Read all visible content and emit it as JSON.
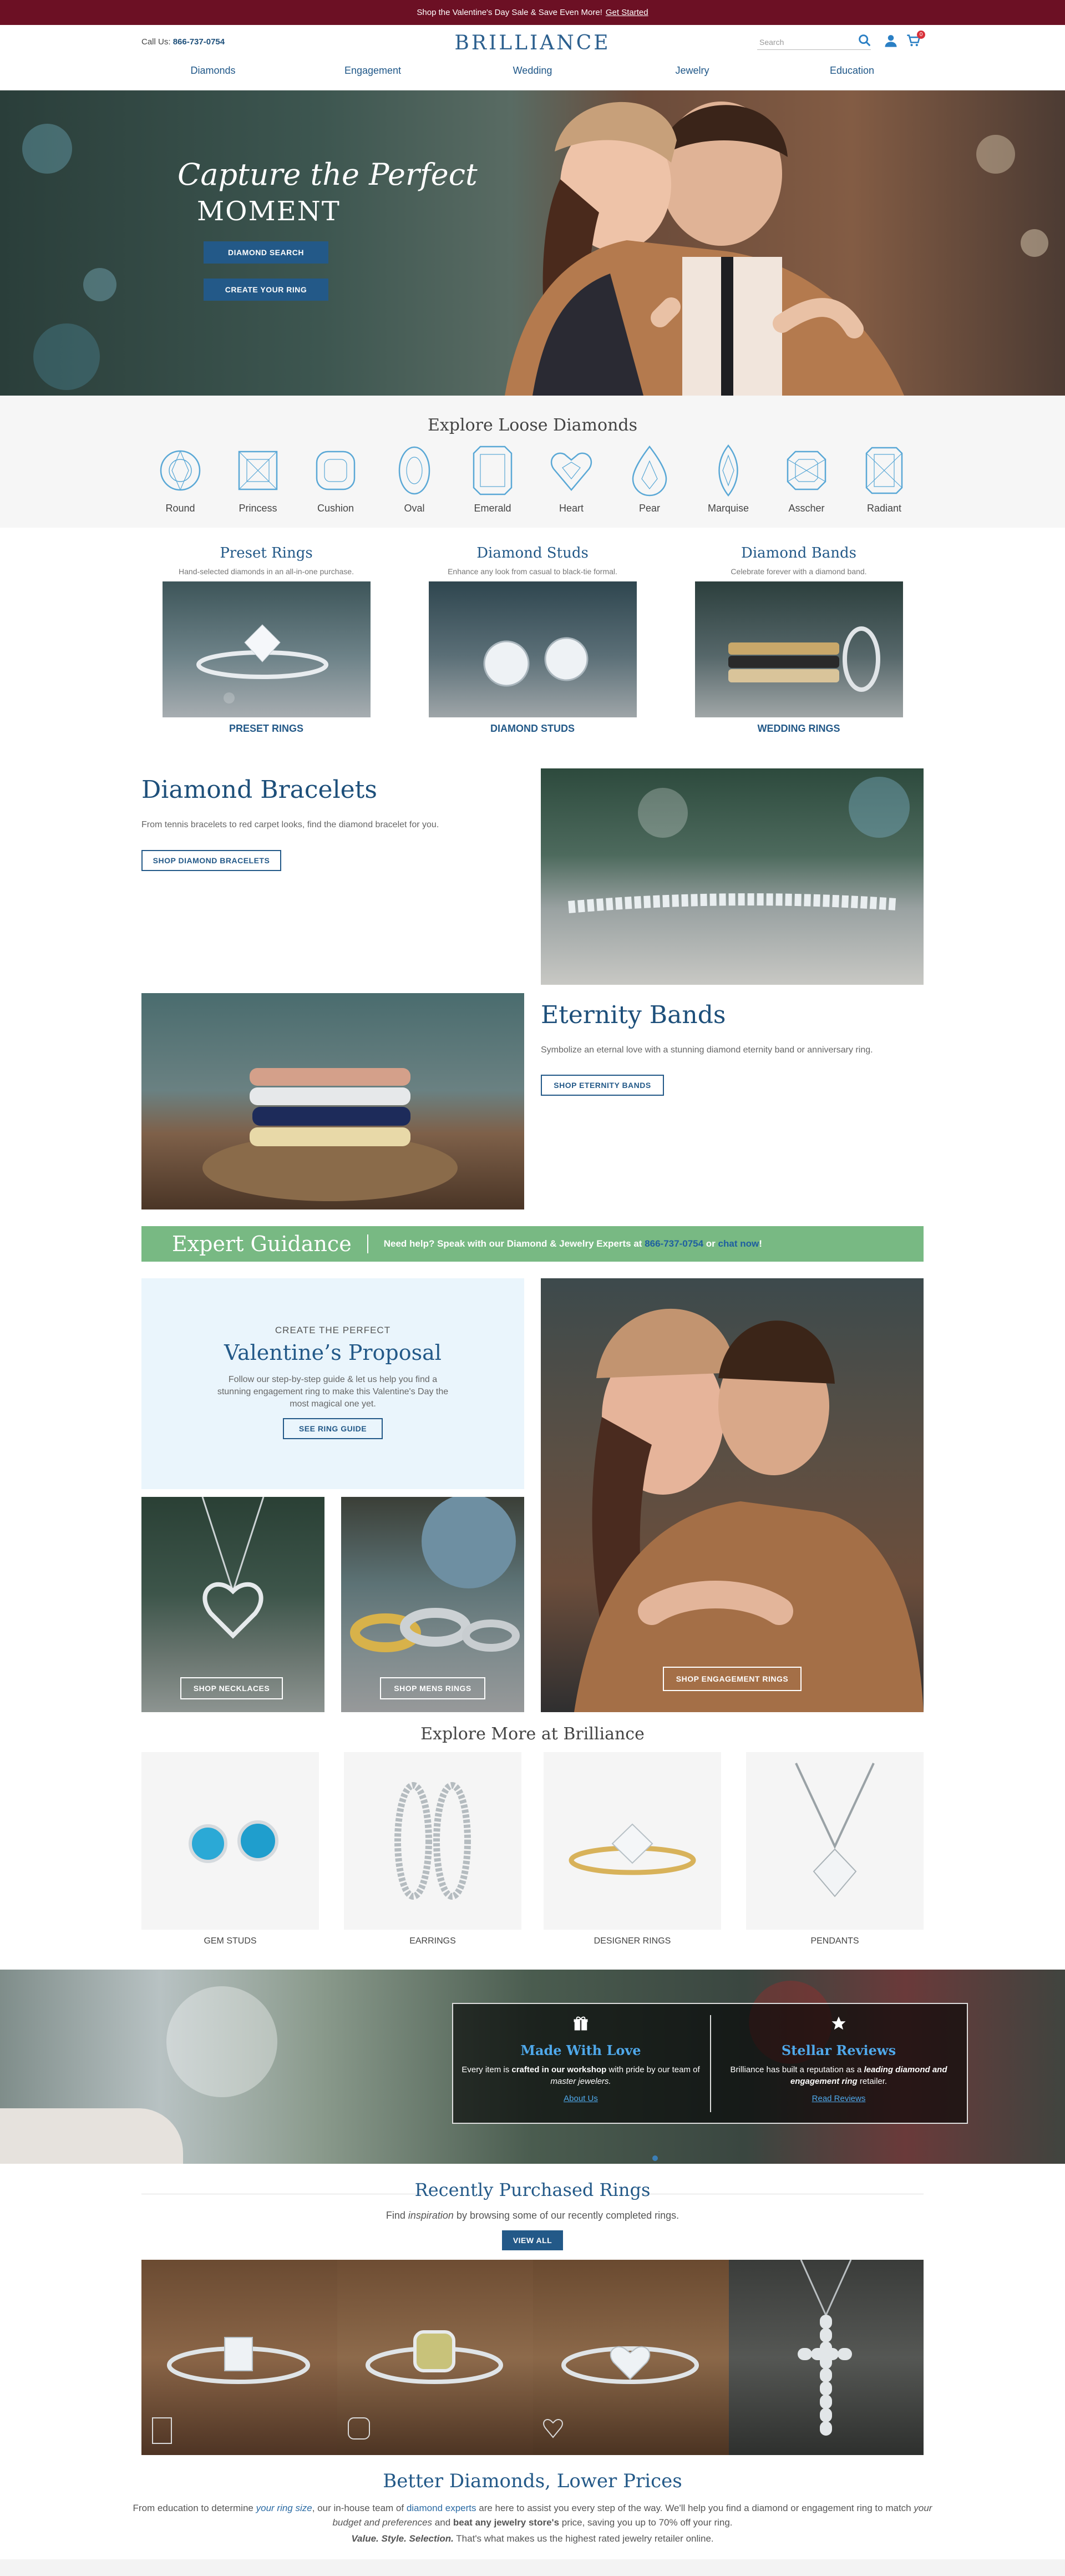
{
  "promo": {
    "text": "Shop the Valentine's Day Sale & Save Even More!",
    "link": "Get Started"
  },
  "header": {
    "phone_label": "Call Us:",
    "phone": "866-737-0754",
    "logo": "BRILLIANCE",
    "search_placeholder": "Search",
    "cart_count": "0",
    "nav": [
      "Diamonds",
      "Engagement",
      "Wedding",
      "Jewelry",
      "Education"
    ]
  },
  "hero": {
    "script": "Capture the Perfect",
    "headline": "MOMENT",
    "btn1": "DIAMOND SEARCH",
    "btn2": "CREATE YOUR RING"
  },
  "shapes": {
    "title": "Explore Loose Diamonds",
    "items": [
      "Round",
      "Princess",
      "Cushion",
      "Oval",
      "Emerald",
      "Heart",
      "Pear",
      "Marquise",
      "Asscher",
      "Radiant"
    ]
  },
  "columns": [
    {
      "title": "Preset Rings",
      "sub": "Hand-selected diamonds in an all-in-one purchase.",
      "link": "PRESET RINGS"
    },
    {
      "title": "Diamond Studs",
      "sub": "Enhance any look from casual to black-tie formal.",
      "link": "DIAMOND STUDS"
    },
    {
      "title": "Diamond Bands",
      "sub": "Celebrate forever with a diamond band.",
      "link": "WEDDING RINGS"
    }
  ],
  "bracelets": {
    "title": "Diamond Bracelets",
    "text": "From tennis bracelets to red carpet looks, find the diamond bracelet for you.",
    "btn": "SHOP DIAMOND BRACELETS"
  },
  "eternity": {
    "title": "Eternity Bands",
    "text": "Symbolize an eternal love with a stunning diamond eternity band or anniversary ring.",
    "btn": "SHOP ETERNITY BANDS"
  },
  "guidance": {
    "title": "Expert Guidance",
    "text": "Need help? Speak with our Diamond & Jewelry Experts at",
    "phone": "866-737-0754",
    "or": "or",
    "chat": "chat now",
    "end": "!"
  },
  "proposal": {
    "eyebrow": "CREATE THE PERFECT",
    "title": "Valentine’s Proposal",
    "text": "Follow our step-by-step guide & let us help you find a stunning engagement ring to make this Valentine's Day the most magical one yet.",
    "btn": "SEE RING GUIDE",
    "necklaces": "SHOP NECKLACES",
    "mens": "SHOP MENS RINGS",
    "engagement": "SHOP ENGAGEMENT RINGS"
  },
  "explore_more": {
    "title": "Explore More at Brilliance",
    "items": [
      "GEM STUDS",
      "EARRINGS",
      "DESIGNER RINGS",
      "PENDANTS"
    ]
  },
  "trust": {
    "made_title": "Made With Love",
    "made_text_1": "Every item is",
    "made_text_bold": "crafted in our workshop",
    "made_text_2": "with pride by our team of",
    "made_text_italic": "master jewelers.",
    "made_link": "About Us",
    "reviews_title": "Stellar Reviews",
    "reviews_text_1": "Brilliance has built a reputation as a",
    "reviews_text_bold": "leading diamond and engagement ring",
    "reviews_text_2": "retailer.",
    "reviews_link": "Read Reviews"
  },
  "recent": {
    "title": "Recently Purchased Rings",
    "sub_1": "Find",
    "sub_italic": "inspiration",
    "sub_2": "by browsing some of our recently completed rings.",
    "btn": "VIEW ALL"
  },
  "bottom": {
    "title": "Better Diamonds, Lower Prices",
    "p1_a": "From education to determine",
    "p1_b": "your ring size",
    "p1_c": ", our in-house team of",
    "p1_d": "diamond experts",
    "p1_e": "are here to assist you every step of the way. We'll help you find a diamond or engagement ring to match",
    "p1_f": "your budget and preferences",
    "p1_g": "and",
    "p1_h": "beat any jewelry store's",
    "p1_i": "price, saving you up to 70% off your ring.",
    "p2_bold": "Value. Style. Selection.",
    "p2_rest": "That's what makes us the highest rated jewelry retailer online."
  },
  "colors": {
    "accent": "#235988",
    "promo": "#6c1024",
    "guidance": "#78b983",
    "trust_link": "#4fa8ea"
  }
}
